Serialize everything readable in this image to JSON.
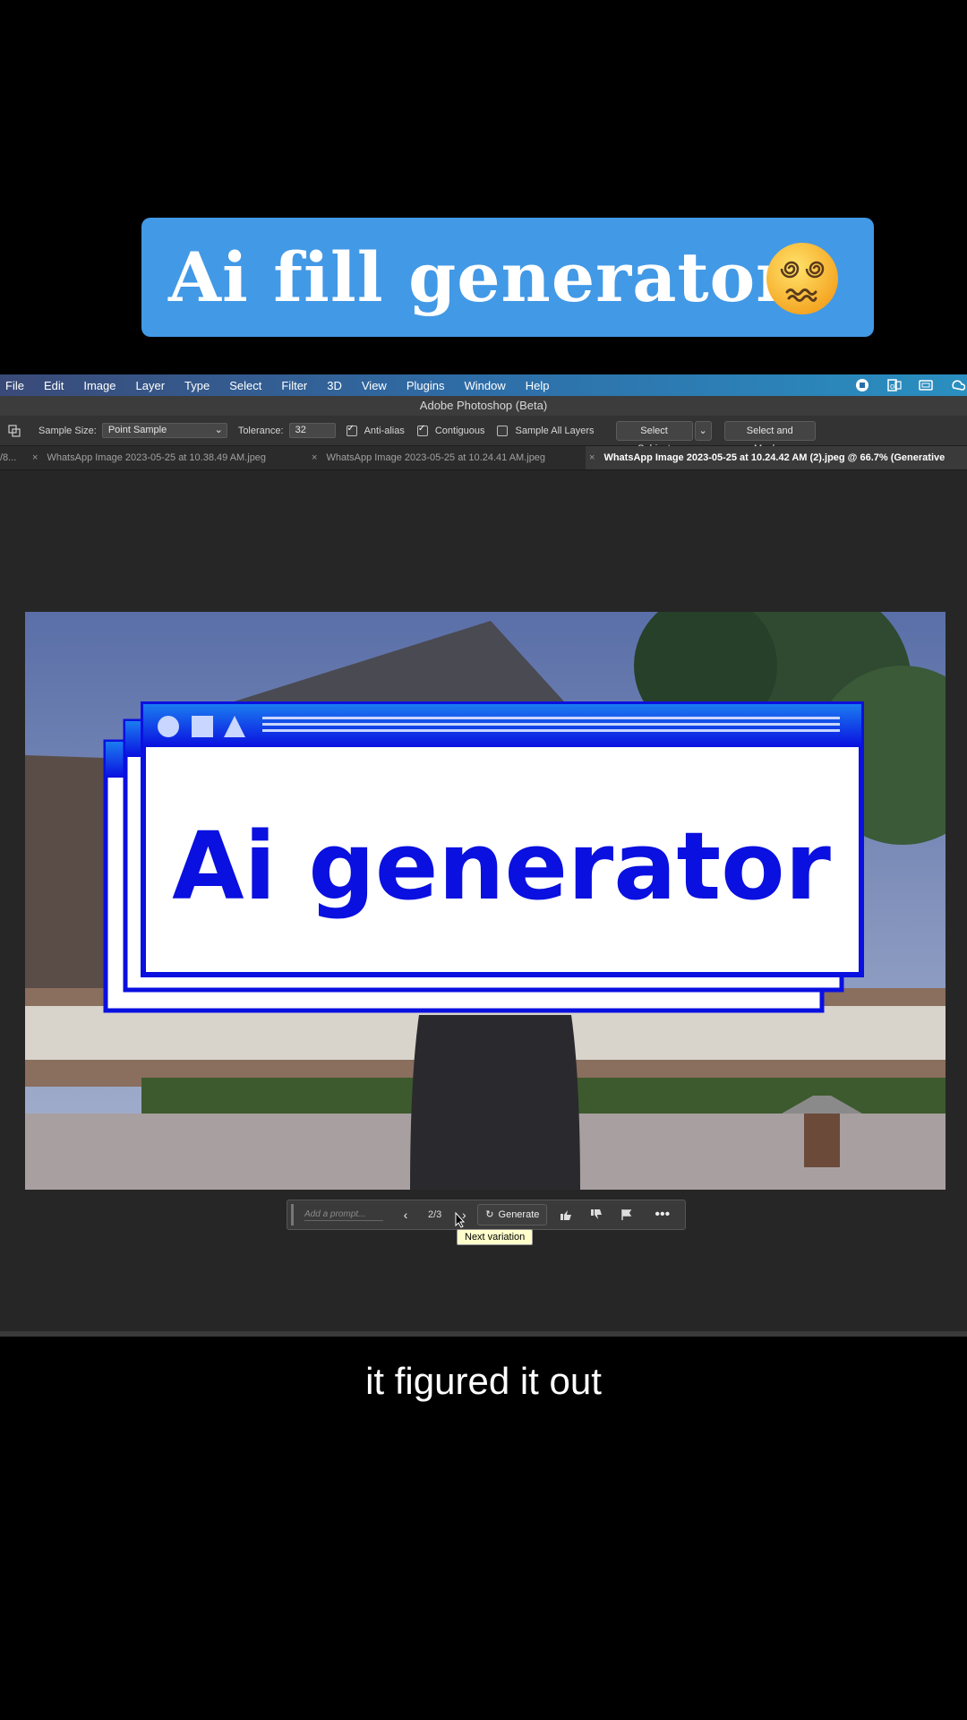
{
  "banner": {
    "title": "Ai fill generator",
    "emoji": "dizzy-face-emoji"
  },
  "menubar": {
    "items": [
      "File",
      "Edit",
      "Image",
      "Layer",
      "Type",
      "Select",
      "Filter",
      "3D",
      "View",
      "Plugins",
      "Window",
      "Help"
    ]
  },
  "app_title": "Adobe Photoshop (Beta)",
  "options_bar": {
    "sample_size_label": "Sample Size:",
    "sample_size_value": "Point Sample",
    "tolerance_label": "Tolerance:",
    "tolerance_value": "32",
    "anti_alias": "Anti-alias",
    "contiguous": "Contiguous",
    "sample_all_layers": "Sample All Layers",
    "select_subject": "Select Subject",
    "select_and_mask": "Select and Mask..."
  },
  "tabs": [
    {
      "label": "/8..."
    },
    {
      "label": "WhatsApp Image 2023-05-25 at 10.38.49 AM.jpeg"
    },
    {
      "label": "WhatsApp Image 2023-05-25 at 10.24.41 AM.jpeg"
    },
    {
      "label": "WhatsApp Image 2023-05-25 at 10.24.42 AM (2).jpeg @ 66.7% (Generative"
    }
  ],
  "canvas": {
    "overlay_text": "Ai generator"
  },
  "gen_bar": {
    "prompt_placeholder": "Add a prompt...",
    "variation_counter": "2/3",
    "generate_label": "Generate"
  },
  "tooltip": "Next variation",
  "caption": "it figured it out",
  "colors": {
    "banner_bg": "#4299e6",
    "overlay_blue": "#0a10e0"
  }
}
